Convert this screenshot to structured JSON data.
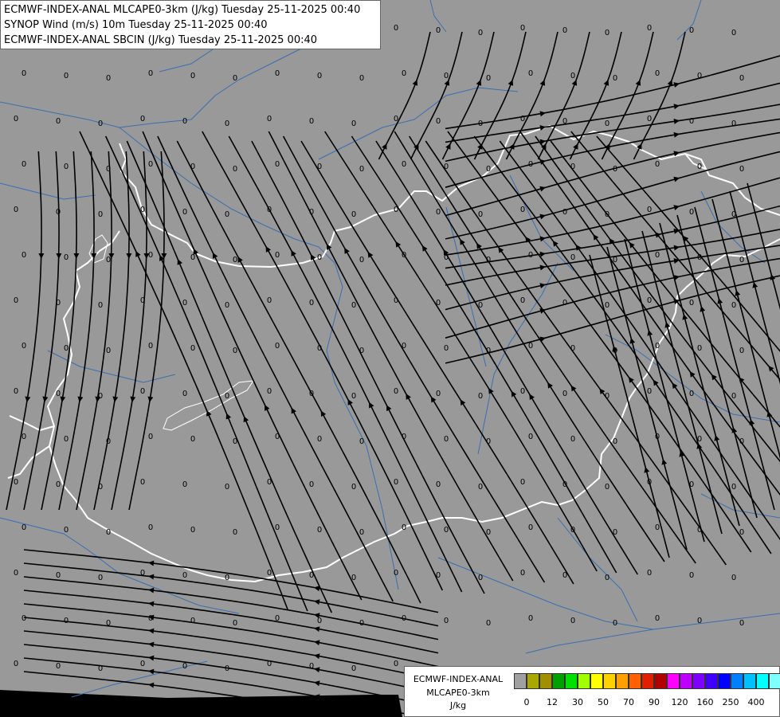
{
  "header": {
    "lines": [
      "ECMWF-INDEX-ANAL MLCAPE0-3km (J/kg) Tuesday 25-11-2025 00:40",
      "SYNOP Wind (m/s) 10m Tuesday 25-11-2025 00:40",
      "ECMWF-INDEX-ANAL SBCIN (J/kg) Tuesday 25-11-2025 00:40"
    ]
  },
  "grid_value_label": "0",
  "colorbar": {
    "title": [
      "ECMWF-INDEX-ANAL",
      "MLCAPE0-3km",
      "J/kg"
    ],
    "colors": [
      "#a0a0a0",
      "#a8a800",
      "#a09000",
      "#00a000",
      "#00e000",
      "#a0ff00",
      "#ffff00",
      "#ffd000",
      "#ffa000",
      "#ff6000",
      "#e02000",
      "#b00000",
      "#ff00ff",
      "#c000ff",
      "#8000ff",
      "#4000ff",
      "#0000ff",
      "#0080ff",
      "#00c0ff",
      "#00ffff",
      "#80ffff",
      "#ffffff"
    ],
    "ticks": [
      {
        "label": "0",
        "index": 1
      },
      {
        "label": "12",
        "index": 3
      },
      {
        "label": "30",
        "index": 5
      },
      {
        "label": "50",
        "index": 7
      },
      {
        "label": "70",
        "index": 9
      },
      {
        "label": "90",
        "index": 11
      },
      {
        "label": "120",
        "index": 13
      },
      {
        "label": "160",
        "index": 15
      },
      {
        "label": "250",
        "index": 17
      },
      {
        "label": "400",
        "index": 19
      }
    ]
  },
  "colors": {
    "background": "#999999",
    "border": "#ffffff",
    "river": "#3a6fb0",
    "streamline": "#000000"
  }
}
